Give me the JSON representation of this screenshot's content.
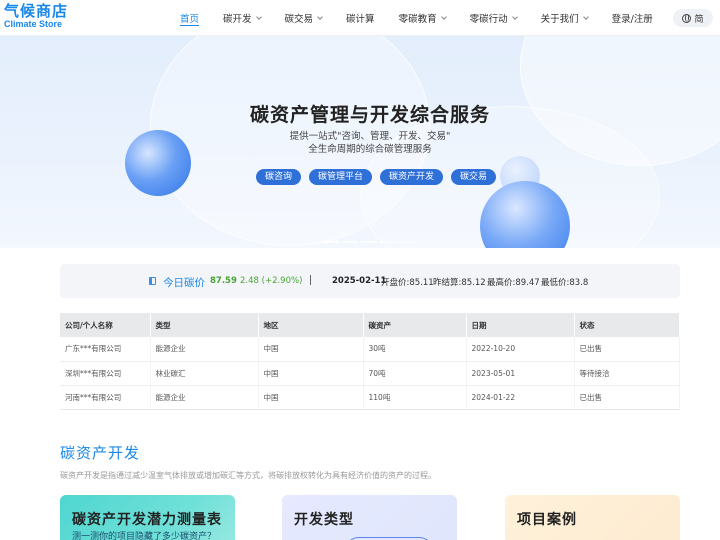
{
  "brand": {
    "name_cn": "气候商店",
    "name_en": "Climate Store",
    "color": "#1a88e8"
  },
  "nav": {
    "items": [
      {
        "label": "首页",
        "active": true,
        "dropdown": false
      },
      {
        "label": "碳开发",
        "active": false,
        "dropdown": true
      },
      {
        "label": "碳交易",
        "active": false,
        "dropdown": true
      },
      {
        "label": "碳计算",
        "active": false,
        "dropdown": false
      },
      {
        "label": "零碳教育",
        "active": false,
        "dropdown": true
      },
      {
        "label": "零碳行动",
        "active": false,
        "dropdown": true
      },
      {
        "label": "关于我们",
        "active": false,
        "dropdown": true
      },
      {
        "label": "登录/注册",
        "active": false,
        "dropdown": false
      }
    ],
    "lang": "简",
    "lang_icon": "globe-icon"
  },
  "hero": {
    "title": "碳资产管理与开发综合服务",
    "subtitle_line1": "提供一站式\"咨询、管理、开发、交易\"",
    "subtitle_line2": "全生命周期的综合碳管理服务",
    "buttons": [
      "碳咨询",
      "碳管理平台",
      "碳资产开发",
      "碳交易"
    ],
    "slides": 5,
    "active_slide": 0
  },
  "price": {
    "label": "今日碳价",
    "icon": "speaker-icon",
    "value": "87.59",
    "change": "2.48 (+2.90%)",
    "change_color": "#4aa336",
    "date": "2025-02-11",
    "open": "开盘价:85.11",
    "close": "昨结算:85.12",
    "high": "最高价:89.47",
    "low": "最低价:83.8"
  },
  "table": {
    "headers": [
      "公司/个人名称",
      "类型",
      "地区",
      "碳资产",
      "日期",
      "状态"
    ],
    "rows": [
      [
        "广东***有限公司",
        "能源企业",
        "中国",
        "30吨",
        "2022-10-20",
        "已出售"
      ],
      [
        "深圳***有限公司",
        "林业碳汇",
        "中国",
        "70吨",
        "2023-05-01",
        "等待接洽"
      ],
      [
        "河南***有限公司",
        "能源企业",
        "中国",
        "110吨",
        "2024-01-22",
        "已出售"
      ]
    ]
  },
  "section": {
    "title": "碳资产开发",
    "desc": "碳资产开发是指通过减少温室气体排放或增加碳汇等方式，将碳排放权转化为具有经济价值的资产的过程。",
    "cards": [
      {
        "title": "碳资产开发潜力测量表",
        "subtitle": "测一测你的项目隐藏了多少碳资产？"
      },
      {
        "title": "开发类型",
        "subtitle": ""
      },
      {
        "title": "项目案例",
        "subtitle": ""
      }
    ]
  }
}
